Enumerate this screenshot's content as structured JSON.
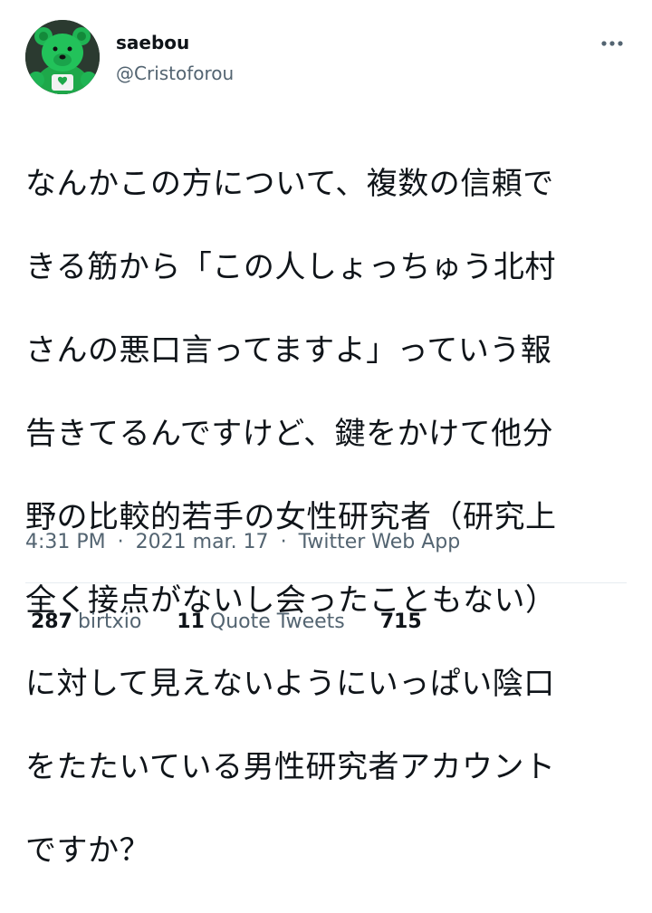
{
  "author": {
    "display_name": "saebou",
    "handle": "@Cristoforou",
    "avatar_icon": "green-teddy-bear-avatar"
  },
  "more_icon": "more-options-icon",
  "tweet": {
    "lines": [
      "なんかこの方について、複数の信頼で",
      "きる筋から「この人しょっちゅう北村",
      "さんの悪口言ってますよ」っていう報",
      "告きてるんですけど、鍵をかけて他分",
      "野の比較的若手の女性研究者（研究上",
      "全く接点がないし会ったこともない）",
      "に対して見えないようにいっぱい陰口",
      "をたたいている男性研究者アカウント",
      "ですか？"
    ]
  },
  "meta": {
    "time": "4:31 PM",
    "date": "2021 mar. 17",
    "source": "Twitter Web App",
    "separator": "·"
  },
  "stats": {
    "retweets_count": "287",
    "retweets_label": "birtxio",
    "quotes_count": "11",
    "quotes_label": "Quote Tweets",
    "likes_count": "715"
  },
  "colors": {
    "text": "#0f1419",
    "secondary": "#536471",
    "divider": "#e6ecf0",
    "avatar_green": "#1db954"
  }
}
